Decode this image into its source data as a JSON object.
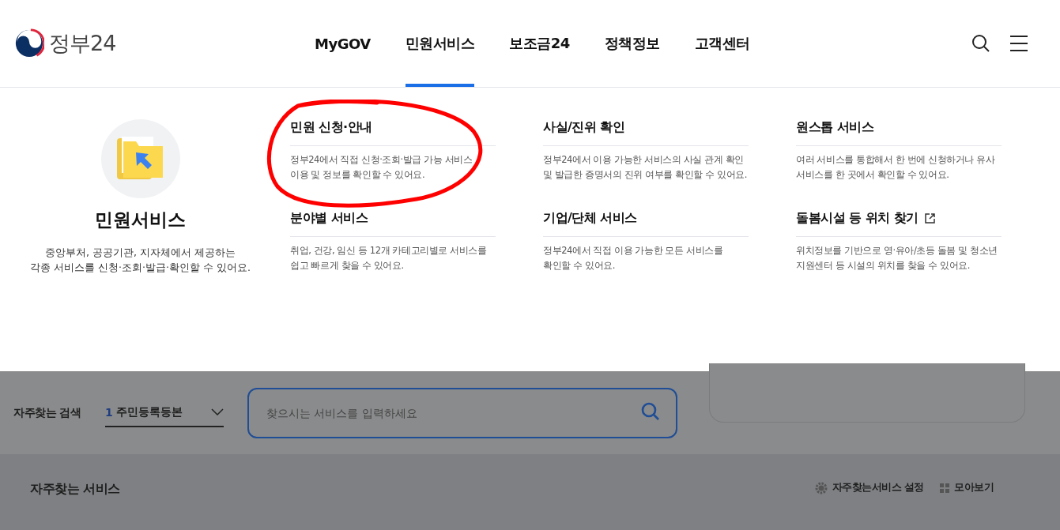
{
  "logo": {
    "text": "정부24"
  },
  "nav": [
    {
      "label": "MyGOV",
      "selected": false
    },
    {
      "label": "민원서비스",
      "selected": true
    },
    {
      "label": "보조금24",
      "selected": false
    },
    {
      "label": "정책정보",
      "selected": false
    },
    {
      "label": "고객센터",
      "selected": false
    }
  ],
  "menu": {
    "title": "민원서비스",
    "description": "중앙부처, 공공기관, 지자체에서 제공하는\n각종 서비스를 신청·조회·발급·확인할 수 있어요.",
    "items": [
      {
        "title": "민원 신청·안내",
        "description": "정부24에서 직접 신청·조회·발급 가능 서비스\n이용 및 정보를 확인할 수 있어요.",
        "external": false,
        "circled": true
      },
      {
        "title": "사실/진위 확인",
        "description": "정부24에서 이용 가능한 서비스의 사실 관계 확인\n및 발급한 증명서의 진위 여부를 확인할 수 있어요.",
        "external": false,
        "circled": false
      },
      {
        "title": "원스톱 서비스",
        "description": "여러 서비스를 통합해서 한 번에 신청하거나 유사\n서비스를 한 곳에서 확인할 수 있어요.",
        "external": false,
        "circled": false
      },
      {
        "title": "분야별 서비스",
        "description": "취업, 건강, 임신 등 12개 카테고리별로 서비스를\n쉽고 빠르게 찾을 수 있어요.",
        "external": false,
        "circled": false
      },
      {
        "title": "기업/단체 서비스",
        "description": "정부24에서 직접 이용 가능한 모든 서비스를\n확인할 수 있어요.",
        "external": false,
        "circled": false
      },
      {
        "title": "돌봄시설 등 위치 찾기",
        "description": "위치정보를 기반으로 영·유아/초등 돌봄 및 청소년\n지원센터 등 시설의 위치를 찾을 수 있어요.",
        "external": true,
        "circled": false
      }
    ]
  },
  "search": {
    "label": "자주찾는 검색",
    "rank": "1",
    "keyword": "주민등록등본",
    "placeholder": "찾으시는 서비스를 입력하세요"
  },
  "frequent": {
    "title": "자주찾는 서비스",
    "settings": "자주찾는서비스 설정",
    "view_all": "모아보기"
  }
}
